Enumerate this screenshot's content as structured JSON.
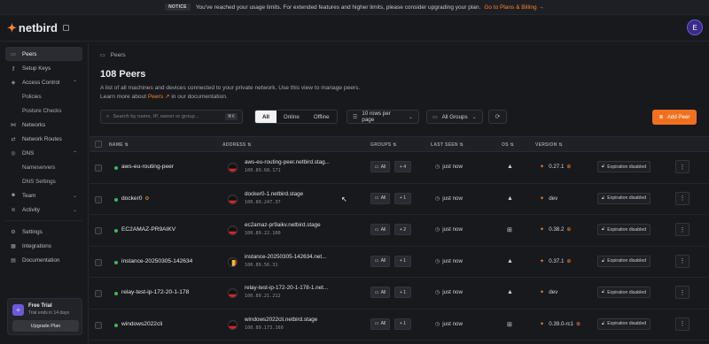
{
  "notice": {
    "tag": "NOTICE",
    "text": "You've reached your usage limits. For extended features and higher limits, please consider upgrading your plan.",
    "link": "Go to Plans & Billing →"
  },
  "brand": {
    "name": "netbird",
    "accent": "#f68330"
  },
  "user": {
    "initial": "E"
  },
  "sidebar": {
    "peers": "Peers",
    "setup_keys": "Setup Keys",
    "access_control": "Access Control",
    "policies": "Policies",
    "posture_checks": "Posture Checks",
    "networks": "Networks",
    "network_routes": "Network Routes",
    "dns": "DNS",
    "nameservers": "Nameservers",
    "dns_settings": "DNS Settings",
    "team": "Team",
    "activity": "Activity",
    "settings": "Settings",
    "integrations": "Integrations",
    "documentation": "Documentation"
  },
  "trial": {
    "title": "Free Trial",
    "subtitle": "Trial ends in 14 days",
    "button": "Upgrade Plan"
  },
  "page": {
    "breadcrumb": "Peers",
    "title": "108 Peers",
    "desc_line1": "A list of all machines and devices connected to your private network. Use this view to manage peers.",
    "desc_prefix": "Learn more about ",
    "desc_link": "Peers",
    "desc_suffix": " in our documentation."
  },
  "toolbar": {
    "search_placeholder": "Search by name, IP, owner or group...",
    "search_kbd": "⌘K",
    "filter_all": "All",
    "filter_online": "Online",
    "filter_offline": "Offline",
    "rows_per_page": "10 rows per page",
    "groups": "All Groups",
    "add_peer": "Add Peer"
  },
  "columns": {
    "name": "NAME",
    "address": "ADDRESS",
    "groups": "GROUPS",
    "last_seen": "LAST SEEN",
    "os": "OS",
    "version": "VERSION"
  },
  "rows": [
    {
      "name": "aws-eu-routing-peer",
      "badge": "",
      "domain": "aws-eu-routing-peer.netbird.stag...",
      "ip": "100.89.68.171",
      "group": "All",
      "more": "+ 4",
      "seen": "just now",
      "os": "▲",
      "version": "0.27.1",
      "update": true,
      "flag": "de",
      "expiration": "Expiration disabled"
    },
    {
      "name": "docker0",
      "badge": "⚙",
      "domain": "docker0-1.netbird.stage",
      "ip": "100.89.247.37",
      "group": "All",
      "more": "+ 1",
      "seen": "just now",
      "os": "▲",
      "version": "dev",
      "update": false,
      "flag": "de",
      "expiration": "Expiration disabled"
    },
    {
      "name": "EC2AMAZ-PR9AIKV",
      "badge": "",
      "domain": "ec2amaz-pr9aikv.netbird.stage",
      "ip": "100.89.22.100",
      "group": "All",
      "more": "+ 2",
      "seen": "just now",
      "os": "⊞",
      "version": "0.38.2",
      "update": true,
      "flag": "de",
      "expiration": "Expiration disabled"
    },
    {
      "name": "instance-20250305-142634",
      "badge": "",
      "domain": "instance-20250305-142634.net...",
      "ip": "100.89.56.31",
      "group": "All",
      "more": "+ 1",
      "seen": "just now",
      "os": "▲",
      "version": "0.37.1",
      "update": true,
      "flag": "be",
      "expiration": "Expiration disabled"
    },
    {
      "name": "relay-test-ip-172-20-1-178",
      "badge": "",
      "domain": "relay-test-ip-172-20-1-178-1.net...",
      "ip": "100.89.21.212",
      "group": "All",
      "more": "+ 1",
      "seen": "just now",
      "os": "▲",
      "version": "dev",
      "update": false,
      "flag": "de",
      "expiration": "Expiration disabled"
    },
    {
      "name": "windows2022cli",
      "badge": "",
      "domain": "windows2022cli.netbird.stage",
      "ip": "100.89.173.160",
      "group": "All",
      "more": "+ 1",
      "seen": "just now",
      "os": "⊞",
      "version": "0.39.0-rc1",
      "update": true,
      "flag": "de",
      "expiration": "Expiration disabled"
    }
  ]
}
